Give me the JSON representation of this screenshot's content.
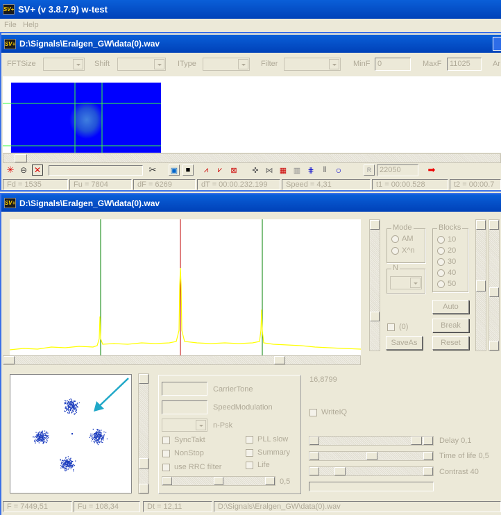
{
  "app": {
    "title": "SV+  (v 3.8.7.9) w-test",
    "logo": "SV+"
  },
  "menu": [
    "File",
    "Help"
  ],
  "win1": {
    "title": "D:\\Signals\\Eralgen_GW\\data(0).wav",
    "toolbar": {
      "fft": "FFTSize",
      "shift": "Shift",
      "itype": "IType",
      "filter": "Filter",
      "minf": "MinF",
      "minf_val": "0",
      "maxf": "MaxF",
      "maxf_val": "11025",
      "ar": "Ar"
    },
    "rate": "22050",
    "status": [
      "Fd = 1535",
      "Fu = 7804",
      "dF = 6269",
      "dT = 00:00.232.199",
      "Speed = 4,31",
      "t1 = 00:00.528",
      "t2 = 00:00.7"
    ]
  },
  "win2": {
    "title": "D:\\Signals\\Eralgen_GW\\data(0).wav",
    "mode": {
      "title": "Mode",
      "am": "AM",
      "xn": "X^n"
    },
    "blocks": {
      "title": "Blocks",
      "items": [
        "10",
        "20",
        "30",
        "40",
        "50"
      ]
    },
    "n": {
      "title": "N"
    },
    "buttons": {
      "auto": "Auto",
      "brk": "Break",
      "save": "SaveAs",
      "reset": "Reset"
    },
    "zero": "(0)",
    "fields": {
      "carrier": "CarrierTone",
      "speed": "SpeedModulation",
      "npsk": "n-Psk"
    },
    "checks": {
      "sync": "SyncTakt",
      "nonstop": "NonStop",
      "rrc": "use RRC filter",
      "pll": "PLL slow",
      "summary": "Summary",
      "life": "Life"
    },
    "slider_val": "0,5",
    "readout": "16,8799",
    "writeiq": "WriteIQ",
    "delay": "Delay  0,1",
    "tol": "Time of life 0,5",
    "contrast": "Contrast 40",
    "status": [
      "F = 7449,51",
      "Fu = 108,34",
      "Dt = 12,11",
      "D:\\Signals\\Eralgen_GW\\data(0).wav"
    ]
  },
  "colors": {
    "title_bar": "#0041b8",
    "waterfall": "#0000ff",
    "spectrum_line": "#ffff00",
    "marker_green": "#008000",
    "marker_red": "#c00000",
    "constellation": "#1f3fbf",
    "arrow": "#20a8c8"
  }
}
